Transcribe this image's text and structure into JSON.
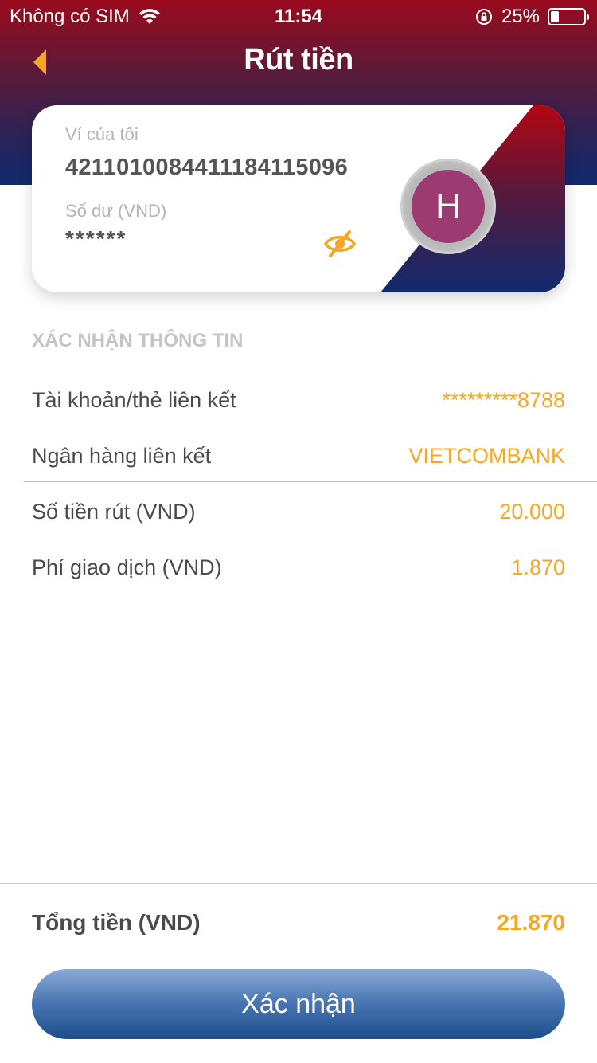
{
  "status_bar": {
    "carrier": "Không có SIM",
    "time": "11:54",
    "battery_percent_text": "25%",
    "battery_level": 0.25,
    "wifi_icon": "wifi-icon",
    "lock_icon": "orientation-lock-icon"
  },
  "header": {
    "title": "Rút tiền",
    "back_icon": "chevron-left-icon"
  },
  "wallet_card": {
    "wallet_label": "Ví của tôi",
    "wallet_number": "421101008441118411509 6",
    "balance_label": "Số dư (VND)",
    "balance_value": "******",
    "eye_icon": "eye-off-icon",
    "avatar_initial": "H"
  },
  "confirm_section": {
    "title": "XÁC NHẬN THÔNG TIN",
    "rows": [
      {
        "label": "Tài khoản/thẻ liên kết",
        "value": "*********8788"
      },
      {
        "label": "Ngân hàng liên kết",
        "value": "VIETCOMBANK"
      },
      {
        "label": "Số tiền rút (VND)",
        "value": "20.000"
      },
      {
        "label": "Phí giao dịch (VND)",
        "value": "1.870"
      }
    ]
  },
  "footer": {
    "total_label": "Tổng tiền (VND)",
    "total_value": "21.870",
    "confirm_label": "Xác nhận"
  },
  "colors": {
    "accent": "#f5a623",
    "header_top": "#9a0a1c",
    "header_bottom": "#0e2a6e",
    "button": "#2f5f9f",
    "avatar": "#9c3a72"
  }
}
